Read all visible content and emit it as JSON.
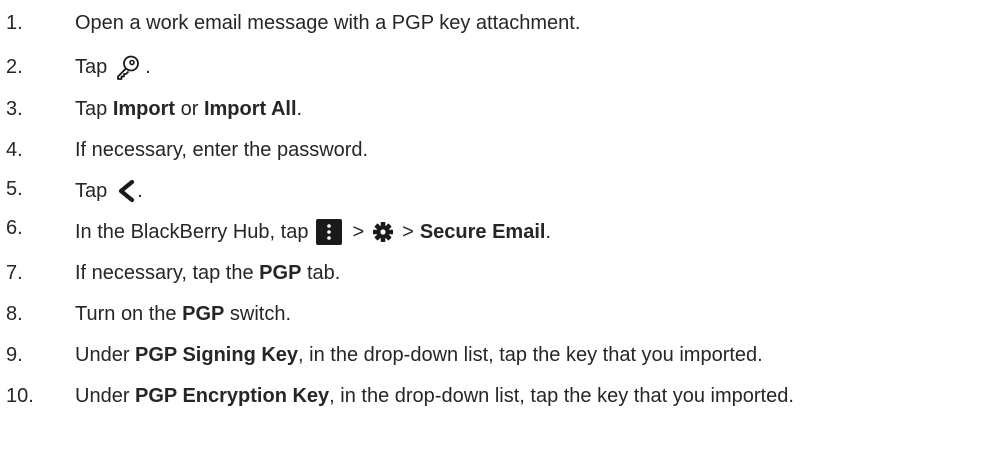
{
  "steps": [
    {
      "num": "1.",
      "text": "Open a work email message with a PGP key attachment."
    },
    {
      "num": "2.",
      "pre": "Tap",
      "icon": "key-icon",
      "post": "."
    },
    {
      "num": "3.",
      "pre": "Tap ",
      "b1": "Import",
      "mid": " or ",
      "b2": "Import All",
      "post": "."
    },
    {
      "num": "4.",
      "text": "If necessary, enter the password."
    },
    {
      "num": "5.",
      "pre": "Tap",
      "icon": "back-chevron-icon",
      "post": "."
    },
    {
      "num": "6.",
      "pre": "In the BlackBerry Hub, tap",
      "icon1": "more-menu-icon",
      "sep1": ">",
      "icon2": "gear-icon",
      "sep2": ">",
      "b1": "Secure Email",
      "post": "."
    },
    {
      "num": "7.",
      "pre": "If necessary, tap the ",
      "b1": "PGP",
      "post": " tab."
    },
    {
      "num": "8.",
      "pre": "Turn on the ",
      "b1": "PGP",
      "post": " switch."
    },
    {
      "num": "9.",
      "pre": "Under ",
      "b1": "PGP Signing Key",
      "post": ", in the drop-down list, tap the key that you imported."
    },
    {
      "num": "10.",
      "pre": "Under ",
      "b1": "PGP Encryption Key",
      "post": ", in the drop-down list, tap the key that you imported."
    }
  ]
}
